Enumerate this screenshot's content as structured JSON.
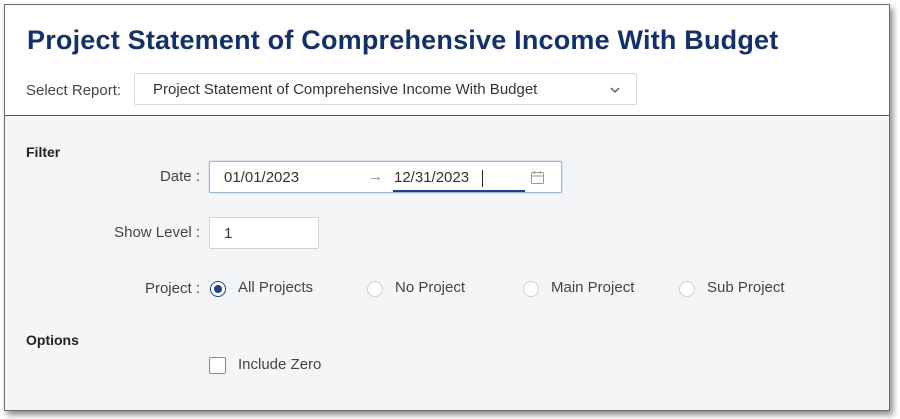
{
  "header": {
    "title": "Project Statement of Comprehensive Income With Budget",
    "select_label": "Select Report:",
    "report_select": {
      "value": "Project Statement of Comprehensive Income With Budget",
      "icon": "chevron-down-icon"
    }
  },
  "filter": {
    "section_title": "Filter",
    "date": {
      "label": "Date :",
      "start": "01/01/2023",
      "separator": "→",
      "end": "12/31/2023",
      "icon": "calendar-icon"
    },
    "show_level": {
      "label": "Show Level :",
      "value": "1"
    },
    "project": {
      "label": "Project :",
      "options": [
        {
          "label": "All Projects",
          "checked": true
        },
        {
          "label": "No Project",
          "checked": false
        },
        {
          "label": "Main Project",
          "checked": false
        },
        {
          "label": "Sub Project",
          "checked": false
        }
      ]
    }
  },
  "options": {
    "section_title": "Options",
    "include_zero": {
      "label": "Include Zero",
      "checked": false
    }
  },
  "colors": {
    "title": "#14306b",
    "accent": "#1f3f8a",
    "panel_bg": "#f4f5f7"
  }
}
